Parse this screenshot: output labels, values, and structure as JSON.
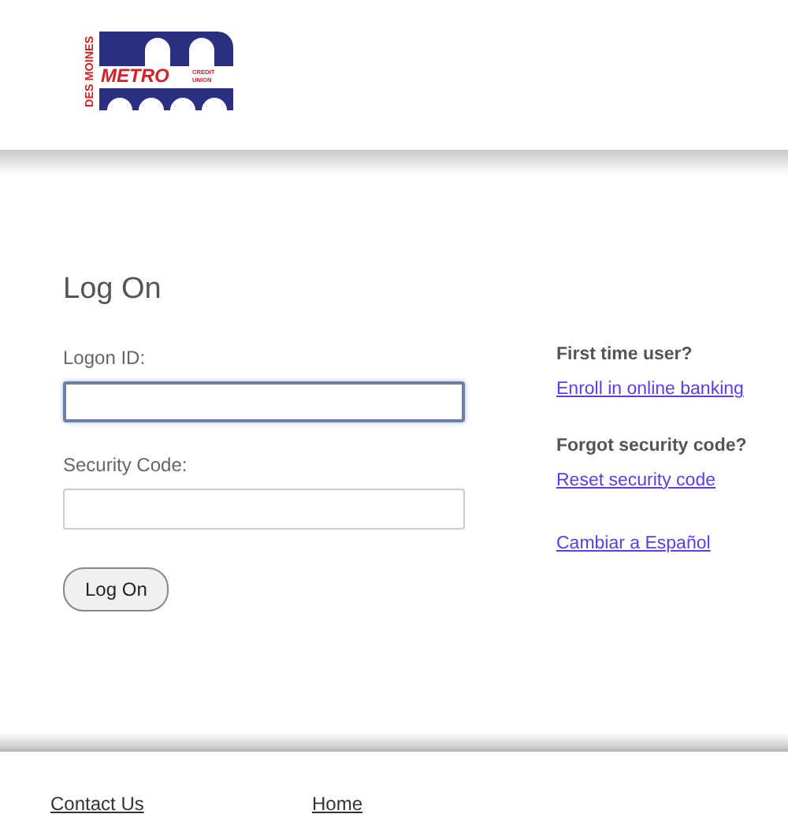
{
  "logo": {
    "side_text": "DES MOINES",
    "main_text": "METRO",
    "tag_lines": [
      "CREDIT",
      "UNION"
    ]
  },
  "form": {
    "title": "Log On",
    "fields": [
      {
        "label": "Logon ID:",
        "focused": true
      },
      {
        "label": "Security Code:",
        "focused": false
      }
    ],
    "submit": "Log On"
  },
  "help": [
    {
      "heading": "First time user?",
      "link": "Enroll in online banking"
    },
    {
      "heading": "Forgot security code?",
      "link": "Reset security code"
    },
    {
      "link": "Cambiar a Español"
    }
  ],
  "footer_links": [
    "Contact Us",
    "Home"
  ]
}
